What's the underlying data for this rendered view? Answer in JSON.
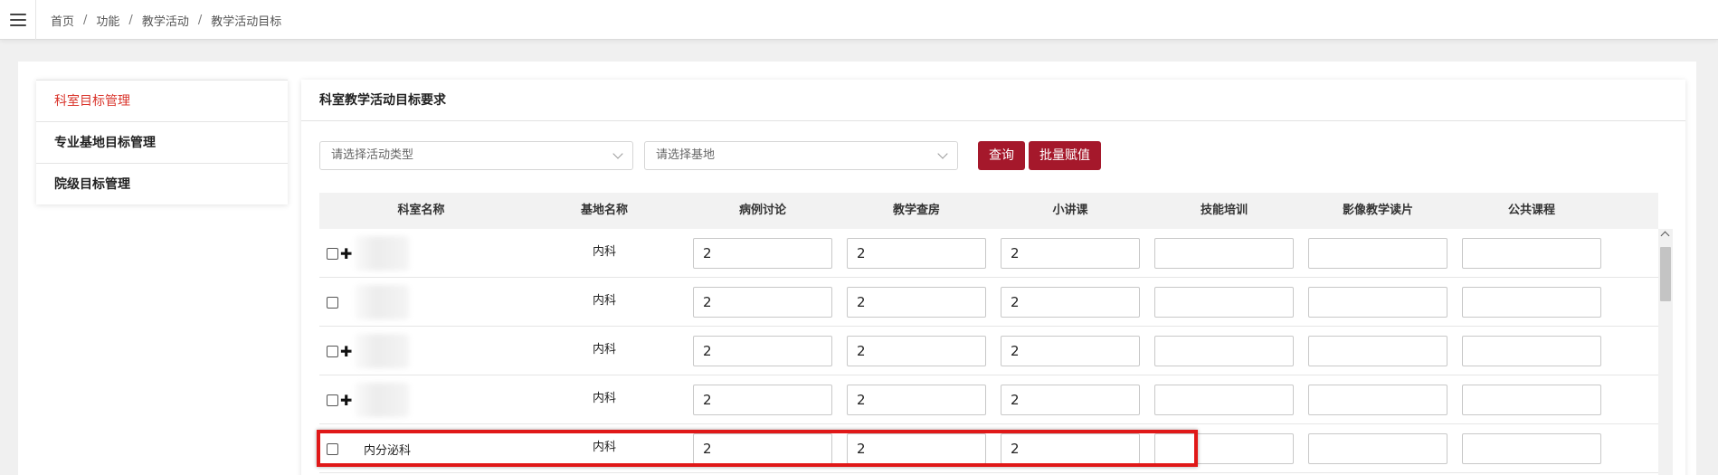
{
  "breadcrumb": {
    "items": [
      "首页",
      "功能",
      "教学活动",
      "教学活动目标"
    ],
    "separator": "/"
  },
  "sidebar": {
    "items": [
      {
        "label": "科室目标管理",
        "active": true
      },
      {
        "label": "专业基地目标管理",
        "active": false
      },
      {
        "label": "院级目标管理",
        "active": false
      }
    ]
  },
  "card": {
    "title": "科室教学活动目标要求"
  },
  "filters": {
    "activity_type_placeholder": "请选择活动类型",
    "base_placeholder": "请选择基地",
    "query_label": "查询",
    "batch_label": "批量赋值"
  },
  "table": {
    "headers": [
      "科室名称",
      "基地名称",
      "病例讨论",
      "教学查房",
      "小讲课",
      "技能培训",
      "影像教学读片",
      "公共课程"
    ],
    "rows": [
      {
        "dept": "",
        "blurred": true,
        "expandable": true,
        "base": "内科",
        "values": [
          "2",
          "2",
          "2",
          "",
          "",
          ""
        ]
      },
      {
        "dept": "",
        "blurred": true,
        "expandable": false,
        "base": "内科",
        "values": [
          "2",
          "2",
          "2",
          "",
          "",
          ""
        ]
      },
      {
        "dept": "",
        "blurred": true,
        "expandable": true,
        "base": "内科",
        "values": [
          "2",
          "2",
          "2",
          "",
          "",
          ""
        ]
      },
      {
        "dept": "",
        "blurred": true,
        "expandable": true,
        "base": "内科",
        "values": [
          "2",
          "2",
          "2",
          "",
          "",
          ""
        ]
      },
      {
        "dept": "内分泌科",
        "blurred": false,
        "expandable": false,
        "base": "内科",
        "values": [
          "2",
          "2",
          "2",
          "",
          "",
          ""
        ]
      }
    ]
  },
  "colors": {
    "accent": "#a5182b",
    "active_nav": "#d9342b",
    "highlight": "#e01818"
  }
}
